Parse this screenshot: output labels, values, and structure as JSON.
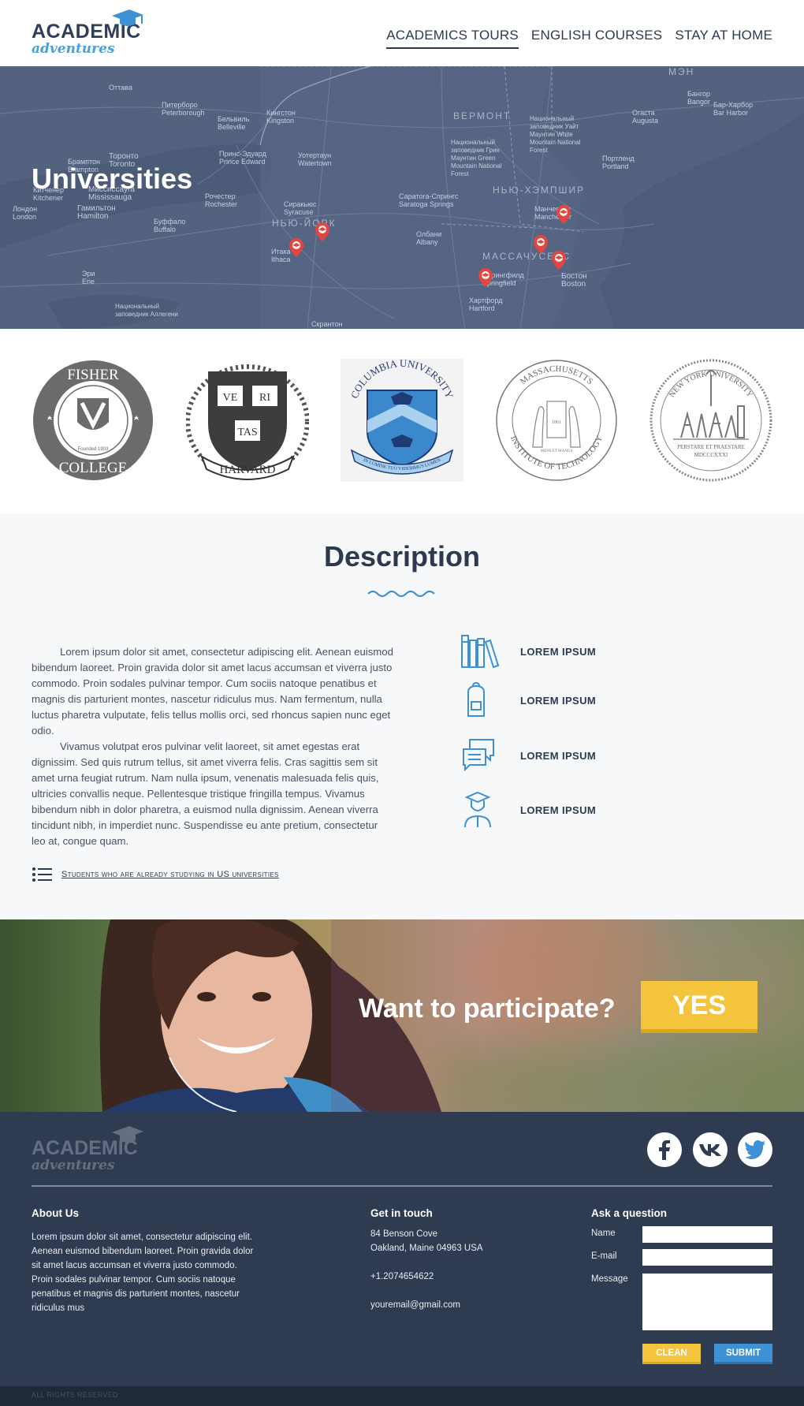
{
  "brand": {
    "line1": "ACADEMIC",
    "line2": "adventures"
  },
  "nav": {
    "items": [
      {
        "label": "ACADEMICS TOURS"
      },
      {
        "label": "ENGLISH COURSES"
      },
      {
        "label": "STAY AT HOME"
      }
    ]
  },
  "hero": {
    "title": "Universities",
    "map_labels": [
      "Оттава",
      "Питерборо Peterborough",
      "Бельвиль Belleville",
      "Кингстон Kingston",
      "Уотертаун Watertown",
      "Принс-Эдуард Prince Edward",
      "Торонто Toronto",
      "Брамптон Brampton",
      "Миссиссауга Mississauga",
      "Китченер Kitchener",
      "Лондон London",
      "Гамильтон Hamilton",
      "Рочестер Rochester",
      "Буффало Buffalo",
      "Сиракьюс Syracuse",
      "Итака Ithaca",
      "Эри Erie",
      "Скрантон",
      "Саратога-Спрингс Saratoga Springs",
      "Олбани Albany",
      "Хартфорд Hartford",
      "Спрингфилд Springfield",
      "Манчестер Manchester",
      "Бостон Boston",
      "Портленд Portland",
      "Огаста Augusta",
      "Бангор Bangor",
      "Бар-Харбор Bar Harbor",
      "Национальный заповедник Грин Маунтин Green Mountain National Forest",
      "Национальный заповедник Уайт Маунтин White Mountain National Forest",
      "Национальный заповедник Аллегени"
    ],
    "region_labels": [
      "ВЕРМОНТ",
      "НЬЮ-ХЭМПШИР",
      "МАССАЧУСЕТС",
      "НЬЮ-ЙОРК",
      "МЭН"
    ]
  },
  "universities": [
    {
      "name": "Fisher College",
      "seal_text_top": "FISHER",
      "seal_text_bottom": "COLLEGE",
      "founded": "Founded 1903"
    },
    {
      "name": "Harvard",
      "seal_words": [
        "VE",
        "RI",
        "TAS"
      ],
      "banner": "HARVARD"
    },
    {
      "name": "Columbia University",
      "seal_text": "COLUMBIA UNIVERSITY",
      "motto": "IN LUMINE TUO VIDEBIMUS LUMEN"
    },
    {
      "name": "Massachusetts Institute of Technology",
      "seal_text_top": "MASSACHUSETTS",
      "seal_text_bottom": "INSTITUTE OF TECHNOLOGY",
      "motto": "MENS ET MANUS",
      "year": "1861"
    },
    {
      "name": "New York University",
      "seal_text": "NEW YORK UNIVERSITY",
      "motto": "PERSTARE ET PRAESTARE",
      "year": "MDCCCXXXI"
    }
  ],
  "description": {
    "title": "Description",
    "paragraphs": [
      "Lorem ipsum dolor sit amet, consectetur adipiscing elit. Aenean euismod bibendum laoreet. Proin gravida dolor sit amet lacus accumsan et viverra justo commodo. Proin sodales pulvinar tempor. Cum sociis natoque penatibus et magnis dis parturient montes, nascetur ridiculus mus. Nam fermentum, nulla luctus pharetra vulputate, felis tellus mollis orci, sed rhoncus sapien nunc eget odio.",
      "Vivamus volutpat eros pulvinar velit laoreet, sit amet egestas erat dignissim. Sed quis rutrum tellus, sit amet viverra felis. Cras sagittis sem sit amet urna feugiat rutrum. Nam nulla ipsum, venenatis malesuada felis quis, ultricies convallis neque. Pellentesque tristique fringilla tempus. Vivamus bibendum nibh in dolor pharetra, a euismod nulla dignissim. Aenean viverra tincidunt nibh, in imperdiet nunc. Suspendisse eu ante pretium, consectetur leo at, congue quam."
    ],
    "students_link": "Students who are already studying in US universities",
    "features": [
      {
        "icon": "books-icon",
        "label": "LOREM IPSUM"
      },
      {
        "icon": "backpack-icon",
        "label": "LOREM IPSUM"
      },
      {
        "icon": "chat-icon",
        "label": "LOREM IPSUM"
      },
      {
        "icon": "graduate-icon",
        "label": "LOREM IPSUM"
      }
    ]
  },
  "cta": {
    "question": "Want to participate?",
    "button": "YES"
  },
  "footer": {
    "about_title": "About Us",
    "about_text": "Lorem ipsum dolor sit amet, consectetur adipiscing elit. Aenean euismod bibendum laoreet. Proin gravida dolor sit amet lacus accumsan et viverra justo commodo. Proin sodales pulvinar tempor. Cum sociis natoque penatibus et magnis dis parturient montes, nascetur ridiculus mus",
    "contact_title": "Get in touch",
    "address_line1": "84 Benson Cove",
    "address_line2": "Oakland, Maine 04963 USA",
    "phone": "+1.2074654622",
    "email": "youremail@gmail.com",
    "form_title": "Ask a question",
    "form": {
      "name_label": "Name",
      "email_label": "E-mail",
      "message_label": "Message",
      "name_value": "",
      "email_value": "",
      "message_value": "",
      "clean_label": "CLEAN",
      "submit_label": "SUBMIT"
    },
    "social": [
      "facebook-icon",
      "vk-icon",
      "twitter-icon"
    ],
    "copyright": "ALL RIGHTS RESERVED"
  },
  "colors": {
    "primary_dark": "#2f3b50",
    "accent_blue": "#3e91d5",
    "accent_yellow": "#f4c43c",
    "map_blue": "#51617f",
    "pin_red": "#e2463e"
  }
}
